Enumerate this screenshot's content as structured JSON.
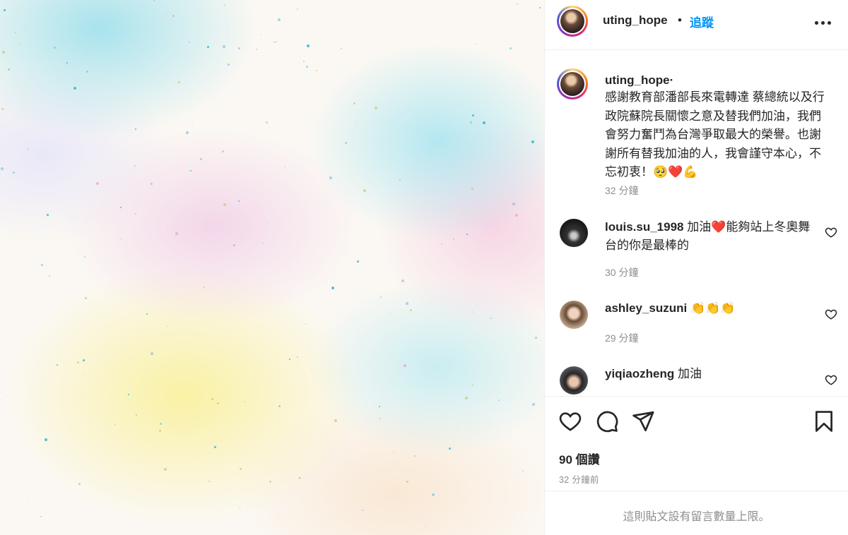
{
  "post": {
    "username": "uting_hope",
    "dot": "•",
    "follow_label": "追蹤",
    "more_icon": "more-horizontal-icon"
  },
  "caption": {
    "username": "uting_hope",
    "suffix": "·",
    "text": "感謝教育部潘部長來電轉達 蔡總統以及行政院蘇院長關懷之意及替我們加油，我們會努力奮鬥為台灣爭取最大的榮譽。也謝謝所有替我加油的人，我會謹守本心，不忘初衷！🥺❤️💪",
    "time": "32 分鐘"
  },
  "comments": [
    {
      "username": "louis.su_1998",
      "text": "加油❤️能夠站上冬奧舞台的你是最棒的",
      "time": "30 分鐘"
    },
    {
      "username": "ashley_suzuni",
      "text": "👏👏👏",
      "time": "29 分鐘"
    },
    {
      "username": "yiqiaozheng",
      "text": "加油",
      "time": ""
    }
  ],
  "likes": "90 個讚",
  "posted_ago": "32 分鐘前",
  "comments_limited": "這則貼文設有留言數量上限。",
  "colors": {
    "link_blue": "#0095f6",
    "text": "#262626",
    "muted": "#8e8e8e",
    "divider": "#efefef"
  }
}
